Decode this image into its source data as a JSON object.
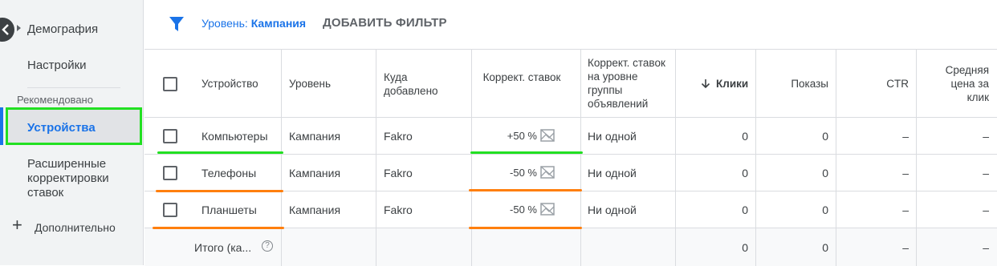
{
  "sidebar": {
    "items": {
      "demography": "Демография",
      "settings": "Настройки",
      "section": "Рекомендовано",
      "devices": "Устройства",
      "advanced": "Расширенные корректировки ставок",
      "more": "Дополнительно"
    }
  },
  "filter": {
    "level_prefix": "Уровень:",
    "level_value": "Кампания",
    "add_filter": "ДОБАВИТЬ ФИЛЬТР"
  },
  "table": {
    "headers": {
      "device": "Устройство",
      "level": "Уровень",
      "added_to": "Куда добавлено",
      "bid_adj": "Коррект. ставок",
      "bid_adj_group": "Коррект. ставок на уровне группы объявлений",
      "clicks": "Клики",
      "impressions": "Показы",
      "ctr": "CTR",
      "avg_cpc": "Средняя цена за клик"
    },
    "rows": [
      {
        "device": "Компьютеры",
        "level": "Кампания",
        "added_to": "Fakro",
        "bid_adj": "+50 %",
        "bid_adj_group": "Ни одной",
        "clicks": "0",
        "impressions": "0",
        "ctr": "–",
        "avg_cpc": "–"
      },
      {
        "device": "Телефоны",
        "level": "Кампания",
        "added_to": "Fakro",
        "bid_adj": "-50 %",
        "bid_adj_group": "Ни одной",
        "clicks": "0",
        "impressions": "0",
        "ctr": "–",
        "avg_cpc": "–"
      },
      {
        "device": "Планшеты",
        "level": "Кампания",
        "added_to": "Fakro",
        "bid_adj": "-50 %",
        "bid_adj_group": "Ни одной",
        "clicks": "0",
        "impressions": "0",
        "ctr": "–",
        "avg_cpc": "–"
      }
    ],
    "total": {
      "label": "Итого (ка...",
      "clicks": "0",
      "impressions": "0",
      "ctr": "–",
      "avg_cpc": "–"
    }
  },
  "colors": {
    "accent": "#1a73e8",
    "highlight_green": "#22e022",
    "highlight_orange": "#ff7f0e"
  }
}
